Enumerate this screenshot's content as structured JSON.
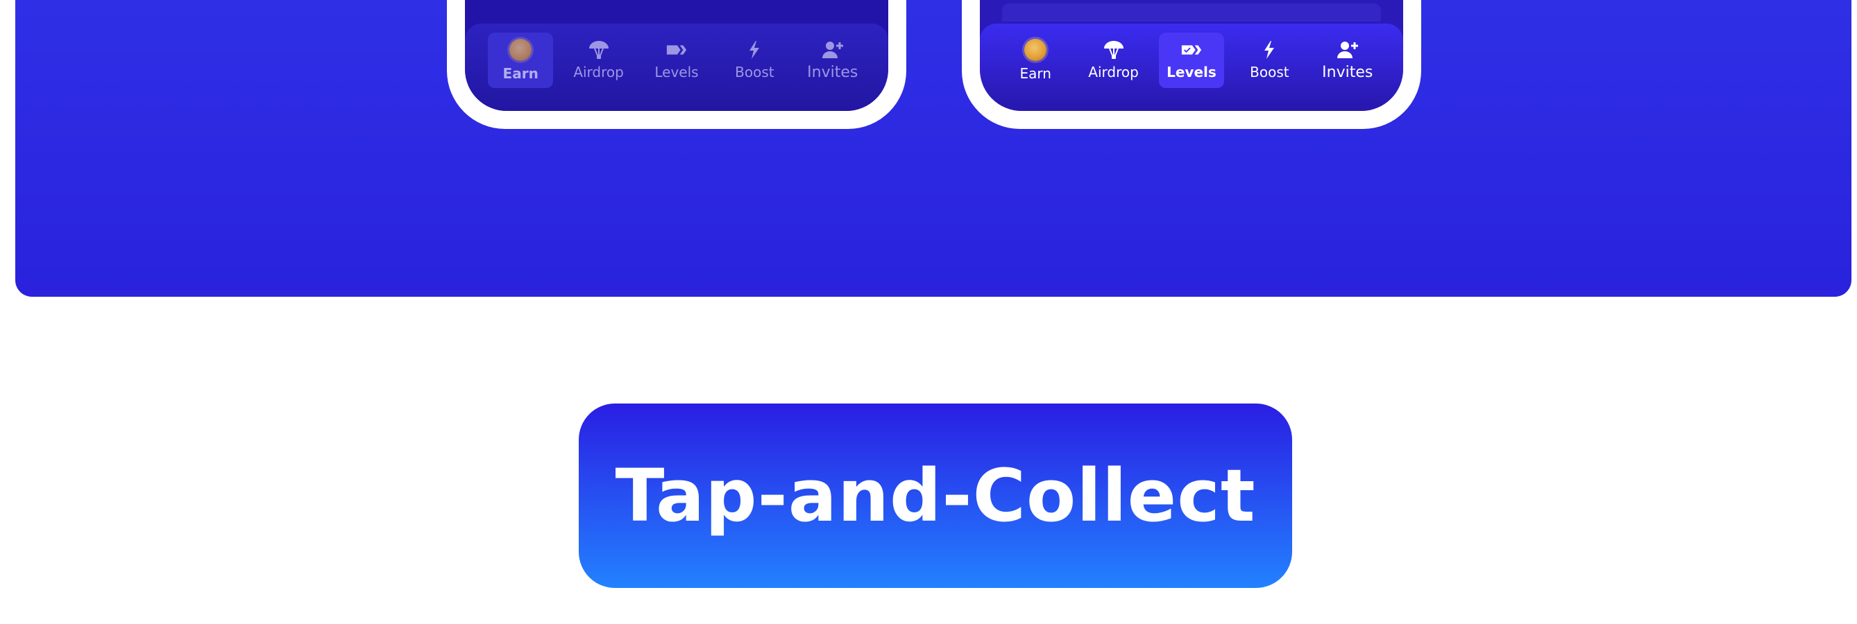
{
  "hero": {
    "background": "#2a22dd"
  },
  "phones": [
    {
      "id": "left",
      "active_tab": "Earn",
      "nav": [
        {
          "label": "Earn",
          "icon": "coin-icon"
        },
        {
          "label": "Airdrop",
          "icon": "parachute-icon"
        },
        {
          "label": "Levels",
          "icon": "levels-icon"
        },
        {
          "label": "Boost",
          "icon": "lightning-icon"
        },
        {
          "label": "Invites",
          "icon": "add-user-icon"
        }
      ]
    },
    {
      "id": "right",
      "active_tab": "Levels",
      "nav": [
        {
          "label": "Earn",
          "icon": "coin-icon"
        },
        {
          "label": "Airdrop",
          "icon": "parachute-icon"
        },
        {
          "label": "Levels",
          "icon": "levels-icon"
        },
        {
          "label": "Boost",
          "icon": "lightning-icon"
        },
        {
          "label": "Invites",
          "icon": "add-user-icon"
        }
      ]
    }
  ],
  "cta": {
    "label": "Tap-and-Collect",
    "gradient_top": "#2a1ee3",
    "gradient_bottom": "#2381ff"
  }
}
